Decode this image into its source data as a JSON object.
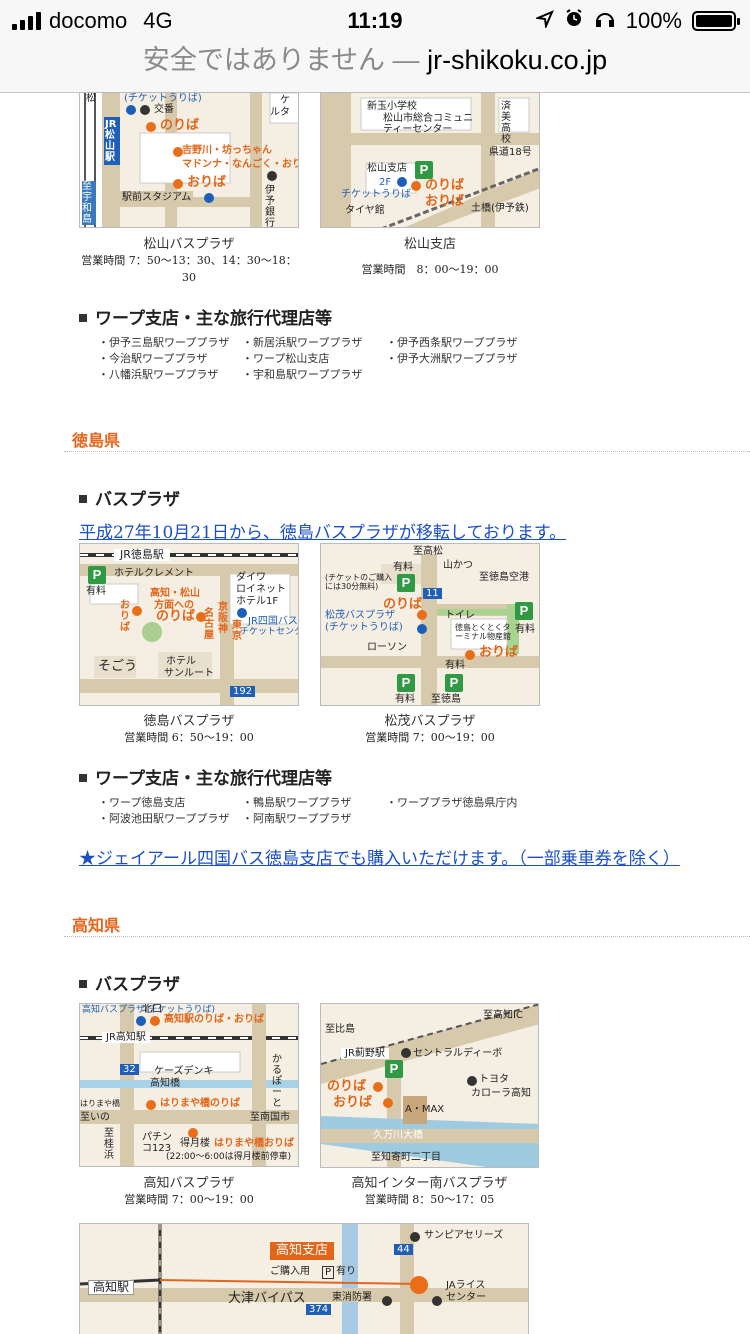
{
  "status_bar": {
    "carrier": "docomo",
    "network": "4G",
    "time": "11:19",
    "battery": "100%"
  },
  "url_bar": {
    "warning": "安全ではありません —",
    "host": "jr-shikoku.co.jp"
  },
  "matsuyama": {
    "map1": {
      "caption": "松山バスプラザ",
      "hours": "営業時間 7：50〜13：30、14：30〜18：30",
      "labels": {
        "top_left": "松",
        "ticket": "(チケットうりば)",
        "koban": "交番",
        "noriba": "のりば",
        "shop": "吉野川・坊っちゃん",
        "shop2": "マドンナ・なんごく・おりば",
        "oriba": "おりば",
        "station": "JR松山駅",
        "stadium": "駅前スタジアム",
        "to_wakajima": "至宇和島",
        "bank": "伊予銀行",
        "top_mid": "ケ",
        "top_mid2": "ルタ"
      }
    },
    "map2": {
      "caption": "松山支店",
      "hours": "営業時間　8：00〜19：00",
      "labels": {
        "school": "新玉小学校",
        "center": "松山市総合コミュニティーセンター",
        "branch": "松山支店",
        "floor": "2F",
        "ticket": "チケットうりば",
        "noriba": "のりば",
        "oriba": "おりば",
        "route": "県道18号",
        "tower": "タイヤ館",
        "station": "土橋(伊予鉄)",
        "hs": "済美高校"
      }
    },
    "agency_heading": "ワープ支店・主な旅行代理店等",
    "agency_rows": [
      [
        "・伊予三島駅ワーププラザ",
        "・新居浜駅ワーププラザ",
        "・伊予西条駅ワーププラザ"
      ],
      [
        "・今治駅ワーププラザ",
        "・ワープ松山支店",
        "・伊予大洲駅ワーププラザ"
      ],
      [
        "・八幡浜駅ワーププラザ",
        "・宇和島駅ワーププラザ",
        ""
      ]
    ]
  },
  "tokushima": {
    "pref": "徳島県",
    "bus_heading": "バスプラザ",
    "notice_link": "平成27年10月21日から、徳島バスプラザが移転しております。",
    "map1": {
      "caption": "徳島バスプラザ",
      "hours": "営業時間 6：50〜19：00",
      "labels": {
        "station": "JR徳島駅",
        "hotel": "ホテルクレメント",
        "yuryo": "有料",
        "oriba": "おりば",
        "kochi": "高知・松山",
        "kochi2": "方面への",
        "noriba": "のりば",
        "nagoya": "名古屋",
        "kyoto": "京阪神",
        "tokyo": "東京",
        "daiwa": "ダイワ",
        "daiwa2": "ロイネット",
        "daiwa3": "ホテル1F",
        "jrbus": "JR四国バス",
        "jrbus2": "チケットセンター",
        "sogo": "そごう",
        "sunroute": "ホテル",
        "sunroute2": "サンルート",
        "r192": "192"
      }
    },
    "map2": {
      "caption": "松茂バスプラザ",
      "hours": "営業時間 7：00〜19：00",
      "labels": {
        "to_kochi": "至高松",
        "yuryo": "有料",
        "yamakatsu": "山かつ",
        "airport": "至徳島空港",
        "ticket_note": "(チケットのご購入には30分無料)",
        "noriba": "のりば",
        "toilet": "トイレ",
        "matsushige": "松茂バスプラザ",
        "ticket": "(チケットうりば)",
        "terminal": "徳島とくとくターミナル物産館",
        "lawson": "ローソン",
        "oriba": "おりば",
        "to_tokushima": "至徳島",
        "r11": "11",
        "yuryo2": "有料",
        "yuryo3": "有料",
        "yuryo4": "有料"
      }
    },
    "agency_heading": "ワープ支店・主な旅行代理店等",
    "agency_rows": [
      [
        "・ワープ徳島支店",
        "・鴨島駅ワーププラザ",
        "・ワーププラザ徳島県庁内"
      ],
      [
        "・阿波池田駅ワーププラザ",
        "・阿南駅ワーププラザ",
        ""
      ]
    ],
    "branch_link": "★ジェイアール四国バス徳島支店でも購入いただけます。（一部乗車券を除く）"
  },
  "kochi": {
    "pref": "高知県",
    "bus_heading": "バスプラザ",
    "map1": {
      "caption": "高知バスプラザ",
      "hours": "営業時間 7：00〜19：00",
      "labels": {
        "ticket": "高知バスプラザ(チケットうりば)",
        "kitaguchi": "北口",
        "noriba": "高知駅のりば・おりば",
        "station": "JR高知駅",
        "r32": "32",
        "ks": "ケーズデンキ",
        "bridge": "高知橋",
        "harimaya": "はりまや橋",
        "noriba2": "はりまや橋のりば",
        "to_ino": "至いの",
        "to_nankoku": "至南国市",
        "pachinko": "パチンコ123",
        "tokugetsu": "得月楼",
        "oriba2": "はりまや橋おりば",
        "night": "(22:00〜6:00は得月楼前停車)",
        "katsura": "至桂浜",
        "karu": "かるぽーと"
      }
    },
    "map2": {
      "caption": "高知インター南バスプラザ",
      "hours": "営業時間 8：50〜17：05",
      "labels": {
        "to_ic": "至高知IC",
        "to_hine": "至比島",
        "station": "JR薊野駅",
        "central": "セントラルディーボ",
        "noriba": "のりば",
        "oriba": "おりば",
        "toyota": "トヨタ",
        "toyota2": "カローラ高知",
        "amax": "A・MAX",
        "bridge": "久万川大橋",
        "to_ni": "至知寄町二丁目"
      }
    },
    "map3": {
      "labels": {
        "branch": "高知支店",
        "purchase": "ご購入用",
        "parking": "P",
        "parking_ex": "有り",
        "station": "高知駅",
        "bypass": "大津バイパス",
        "sunpia": "サンピアセリーズ",
        "ja": "JAライス",
        "ja2": "センター",
        "fire": "東消防署",
        "r44": "44",
        "r374": "374"
      }
    }
  }
}
